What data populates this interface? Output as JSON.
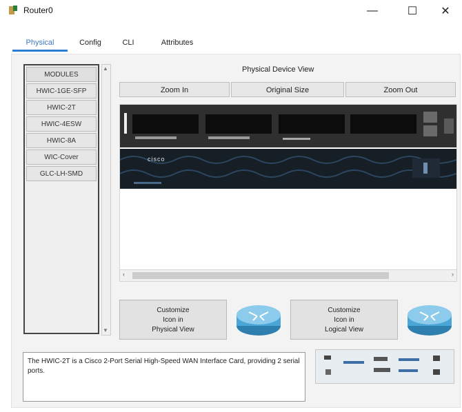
{
  "window": {
    "title": "Router0",
    "minimize": "—",
    "maximize": "☐",
    "close": "✕",
    "icon": "router-app-icon"
  },
  "tabs": [
    {
      "label": "Physical",
      "active": true
    },
    {
      "label": "Config",
      "active": false
    },
    {
      "label": "CLI",
      "active": false
    },
    {
      "label": "Attributes",
      "active": false
    }
  ],
  "modules": {
    "header": "MODULES",
    "items": [
      "HWIC-1GE-SFP",
      "HWIC-2T",
      "HWIC-4ESW",
      "HWIC-8A",
      "WIC-Cover",
      "GLC-LH-SMD"
    ]
  },
  "physical_view": {
    "label": "Physical Device View",
    "zoom_in": "Zoom In",
    "original_size": "Original Size",
    "zoom_out": "Zoom Out",
    "brand": "cisco",
    "colors": {
      "router_top": "#2f2f2f",
      "router_bottom": "#161e26",
      "tab_accent": "#2d7dd2"
    }
  },
  "customize": {
    "physical": [
      "Customize",
      "Icon in",
      "Physical View"
    ],
    "logical": [
      "Customize",
      "Icon in",
      "Logical View"
    ]
  },
  "description": "The HWIC-2T is a Cisco 2-Port Serial High-Speed WAN Interface Card, providing 2 serial ports."
}
